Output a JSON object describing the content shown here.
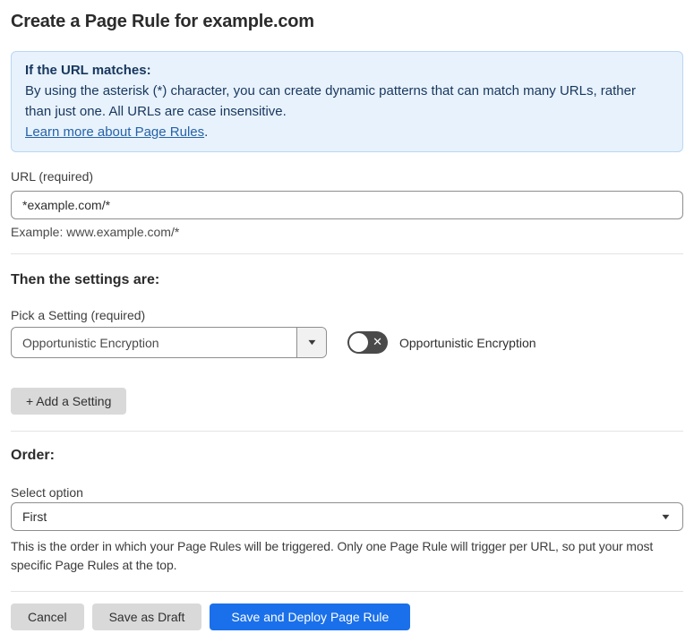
{
  "page": {
    "title": "Create a Page Rule for example.com"
  },
  "info_box": {
    "heading": "If the URL matches:",
    "body": "By using the asterisk (*) character, you can create dynamic patterns that can match many URLs, rather than just one. All URLs are case insensitive.",
    "link_label": "Learn more about Page Rules",
    "link_suffix": "."
  },
  "url_field": {
    "label": "URL (required)",
    "value": "*example.com/*",
    "helper": "Example: www.example.com/*"
  },
  "settings_section": {
    "heading": "Then the settings are:",
    "picker_label": "Pick a Setting (required)",
    "picker_value": "Opportunistic Encryption",
    "toggle_state": "off",
    "toggle_label": "Opportunistic Encryption",
    "add_setting_label": "+ Add a Setting"
  },
  "order_section": {
    "heading": "Order:",
    "select_label": "Select option",
    "select_value": "First",
    "helper": "This is the order in which your Page Rules will be triggered. Only one Page Rule will trigger per URL, so put your most specific Page Rules at the top."
  },
  "footer": {
    "cancel_label": "Cancel",
    "save_draft_label": "Save as Draft",
    "save_deploy_label": "Save and Deploy Page Rule"
  },
  "icons": {
    "dropdown_caret": "▼",
    "toggle_x": "✕"
  },
  "colors": {
    "info_bg": "#e8f2fc",
    "info_border": "#b9d7f3",
    "info_text": "#17375e",
    "link": "#2563a8",
    "primary_button": "#1a70ea",
    "toggle_off_bg": "#4a4a4a",
    "gray_button": "#d9d9d9",
    "input_border": "#8e8e8e",
    "divider": "#e3e3e3"
  }
}
